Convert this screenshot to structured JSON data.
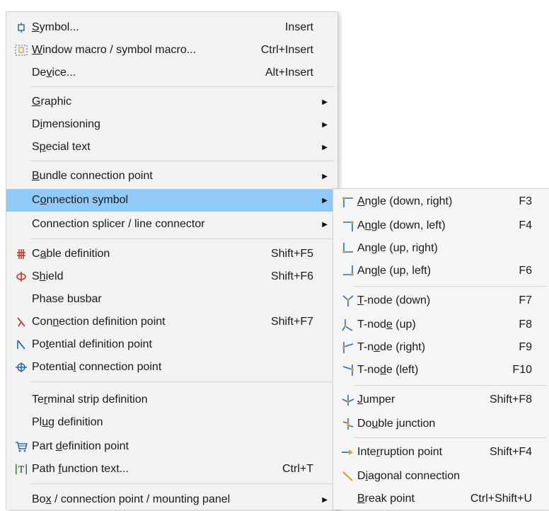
{
  "main_menu": {
    "items": [
      {
        "id": "symbol",
        "pre": "",
        "u": "S",
        "post": "ymbol...",
        "shortcut": "Insert",
        "icon": "symbol-icon"
      },
      {
        "id": "window-macro",
        "pre": "",
        "u": "W",
        "post": "indow macro / symbol macro...",
        "shortcut": "Ctrl+Insert",
        "icon": "window-macro-icon"
      },
      {
        "id": "device",
        "pre": "De",
        "u": "v",
        "post": "ice...",
        "shortcut": "Alt+Insert"
      },
      {
        "id": "graphic",
        "pre": "",
        "u": "G",
        "post": "raphic",
        "submenu": true
      },
      {
        "id": "dimensioning",
        "pre": "D",
        "u": "i",
        "post": "mensioning",
        "submenu": true
      },
      {
        "id": "special-text",
        "pre": "S",
        "u": "p",
        "post": "ecial text",
        "submenu": true
      },
      {
        "id": "bundle-connection-point",
        "pre": "",
        "u": "B",
        "post": "undle connection point",
        "submenu": true
      },
      {
        "id": "connection-symbol",
        "pre": "C",
        "u": "o",
        "post": "nnection symbol",
        "submenu": true,
        "highlighted": true
      },
      {
        "id": "connection-splicer",
        "pre": "Connection splicer / line connector",
        "u": "",
        "post": "",
        "submenu": true
      },
      {
        "id": "cable-definition",
        "pre": "C",
        "u": "a",
        "post": "ble definition",
        "shortcut": "Shift+F5",
        "icon": "cable-icon"
      },
      {
        "id": "shield",
        "pre": "S",
        "u": "h",
        "post": "ield",
        "shortcut": "Shift+F6",
        "icon": "shield-icon"
      },
      {
        "id": "phase-busbar",
        "pre": "Phase busbar",
        "u": "",
        "post": ""
      },
      {
        "id": "connection-definition-point",
        "pre": "Con",
        "u": "n",
        "post": "ection definition point",
        "shortcut": "Shift+F7",
        "icon": "connection-definition-icon"
      },
      {
        "id": "potential-definition-point",
        "pre": "Po",
        "u": "t",
        "post": "ential definition point",
        "icon": "potential-definition-icon"
      },
      {
        "id": "potential-connection-point",
        "pre": "Potentia",
        "u": "l",
        "post": " connection point",
        "icon": "potential-connection-icon"
      },
      {
        "id": "terminal-strip-definition",
        "pre": "Te",
        "u": "r",
        "post": "minal strip definition"
      },
      {
        "id": "plug-definition",
        "pre": "Pl",
        "u": "u",
        "post": "g definition"
      },
      {
        "id": "part-definition-point",
        "pre": "Part ",
        "u": "d",
        "post": "efinition point",
        "icon": "part-icon"
      },
      {
        "id": "path-function-text",
        "pre": "Path ",
        "u": "f",
        "post": "unction text...",
        "shortcut": "Ctrl+T",
        "icon": "path-text-icon"
      },
      {
        "id": "box-connection-point",
        "pre": "Bo",
        "u": "x",
        "post": " / connection point / mounting panel",
        "submenu": true
      }
    ]
  },
  "sub_menu": {
    "items": [
      {
        "id": "angle-down-right",
        "pre": "",
        "u": "A",
        "post": "ngle (down, right)",
        "shortcut": "F3",
        "icon": "angle-down-right-icon"
      },
      {
        "id": "angle-down-left",
        "pre": "A",
        "u": "n",
        "post": "gle (down, left)",
        "shortcut": "F4",
        "icon": "angle-down-left-icon"
      },
      {
        "id": "angle-up-right",
        "pre": "An",
        "u": "g",
        "post": "le (up, right)",
        "icon": "angle-up-right-icon"
      },
      {
        "id": "angle-up-left",
        "pre": "Ang",
        "u": "l",
        "post": "e (up, left)",
        "shortcut": "F6",
        "icon": "angle-up-left-icon"
      },
      {
        "id": "t-node-down",
        "pre": "",
        "u": "T",
        "post": "-node (down)",
        "shortcut": "F7",
        "icon": "t-node-down-icon"
      },
      {
        "id": "t-node-up",
        "pre": "T-nod",
        "u": "e",
        "post": " (up)",
        "shortcut": "F8",
        "icon": "t-node-up-icon"
      },
      {
        "id": "t-node-right",
        "pre": "T-n",
        "u": "o",
        "post": "de (right)",
        "shortcut": "F9",
        "icon": "t-node-right-icon"
      },
      {
        "id": "t-node-left",
        "pre": "T-no",
        "u": "d",
        "post": "e (left)",
        "shortcut": "F10",
        "icon": "t-node-left-icon"
      },
      {
        "id": "jumper",
        "pre": "",
        "u": "J",
        "post": "umper",
        "shortcut": "Shift+F8",
        "icon": "jumper-icon"
      },
      {
        "id": "double-junction",
        "pre": "Do",
        "u": "u",
        "post": "ble junction",
        "icon": "double-junction-icon"
      },
      {
        "id": "interruption-point",
        "pre": "Inte",
        "u": "r",
        "post": "ruption point",
        "shortcut": "Shift+F4",
        "icon": "interruption-point-icon"
      },
      {
        "id": "diagonal-connection",
        "pre": "D",
        "u": "i",
        "post": "agonal connection",
        "icon": "diagonal-connection-icon"
      },
      {
        "id": "break-point",
        "pre": "",
        "u": "B",
        "post": "reak point",
        "shortcut": "Ctrl+Shift+U"
      }
    ]
  },
  "colors": {
    "highlight": "#91c9f7",
    "icon_red": "#c0392b",
    "icon_blue": "#2b6cb0",
    "icon_orange": "#e29a2d"
  }
}
